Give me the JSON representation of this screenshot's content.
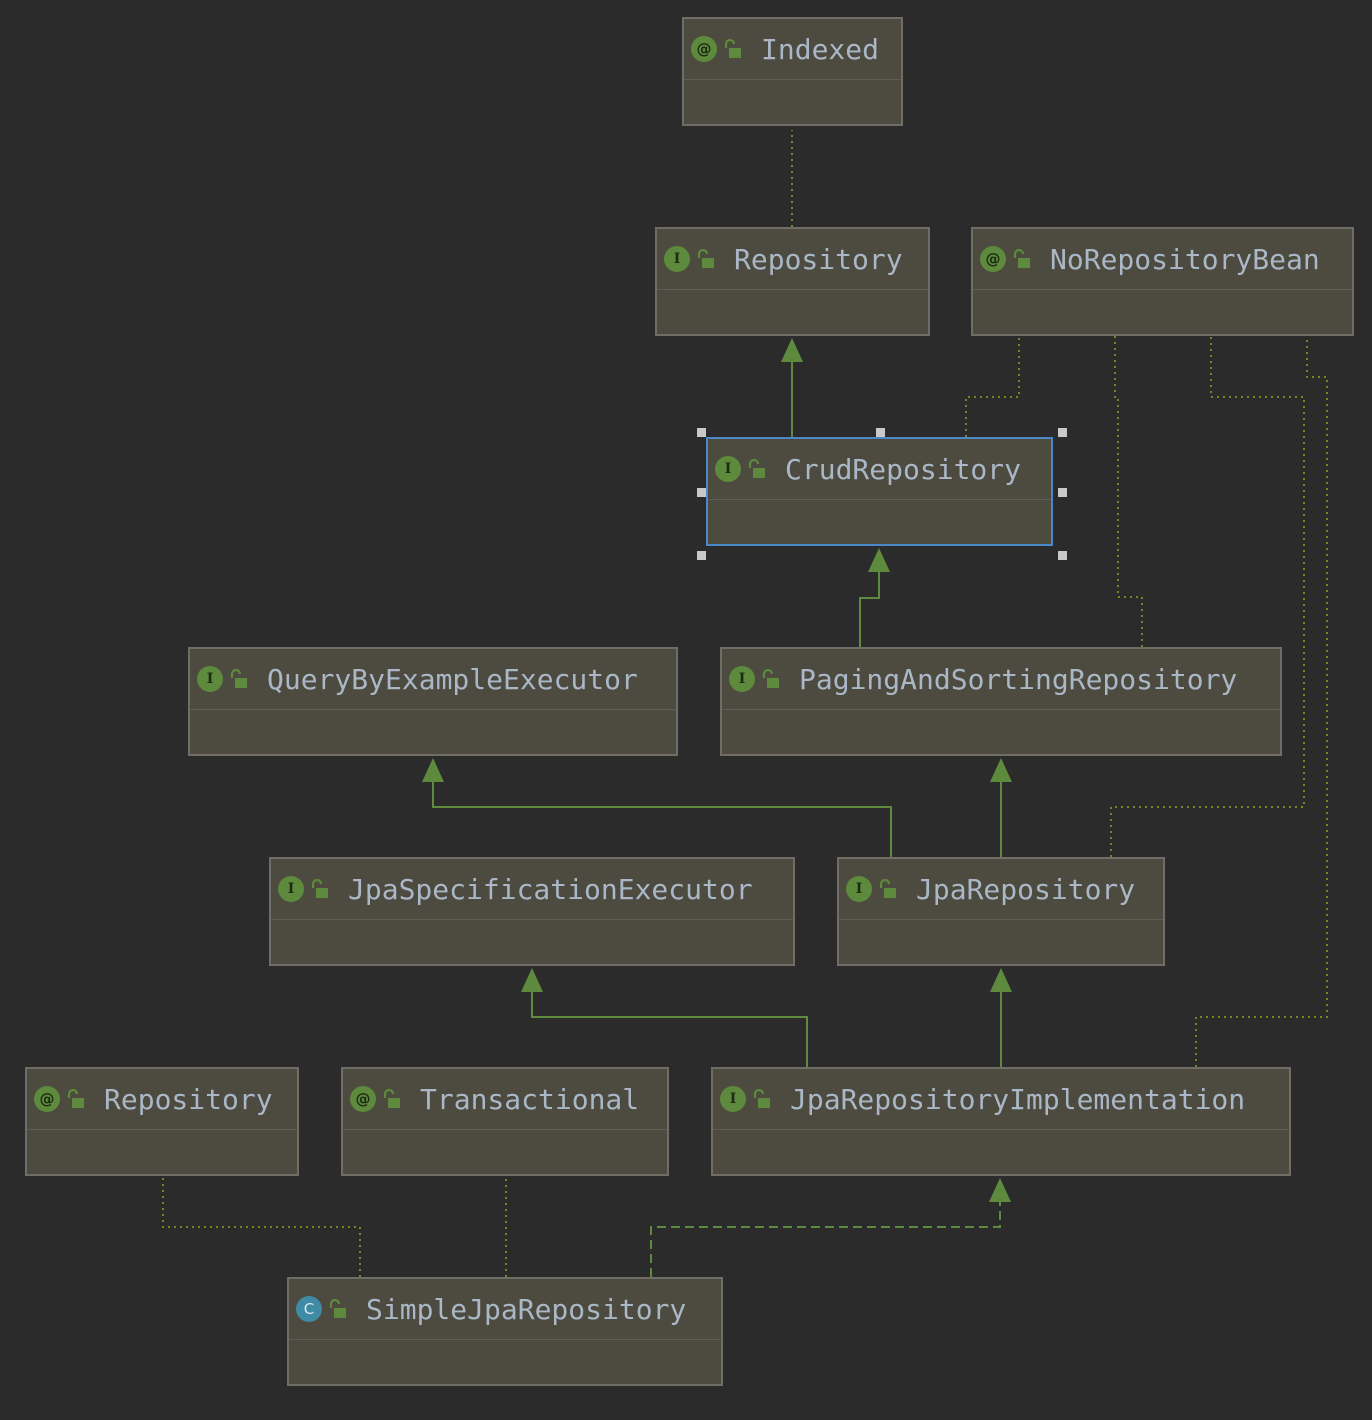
{
  "nodes": [
    {
      "id": "indexed",
      "name": "Indexed",
      "kind": "annotation",
      "badge": "@"
    },
    {
      "id": "repository",
      "name": "Repository",
      "kind": "interface",
      "badge": "I"
    },
    {
      "id": "no-repository-bean",
      "name": "NoRepositoryBean",
      "kind": "annotation",
      "badge": "@"
    },
    {
      "id": "crud-repository",
      "name": "CrudRepository",
      "kind": "interface",
      "badge": "I",
      "selected": true
    },
    {
      "id": "query-by-example-executor",
      "name": "QueryByExampleExecutor",
      "kind": "interface",
      "badge": "I"
    },
    {
      "id": "paging-and-sorting-repository",
      "name": "PagingAndSortingRepository",
      "kind": "interface",
      "badge": "I"
    },
    {
      "id": "jpa-specification-executor",
      "name": "JpaSpecificationExecutor",
      "kind": "interface",
      "badge": "I"
    },
    {
      "id": "jpa-repository",
      "name": "JpaRepository",
      "kind": "interface",
      "badge": "I"
    },
    {
      "id": "repository-annotation",
      "name": "Repository",
      "kind": "annotation",
      "badge": "@"
    },
    {
      "id": "transactional",
      "name": "Transactional",
      "kind": "annotation",
      "badge": "@"
    },
    {
      "id": "jpa-repository-implementation",
      "name": "JpaRepositoryImplementation",
      "kind": "interface",
      "badge": "I"
    },
    {
      "id": "simple-jpa-repository",
      "name": "SimpleJpaRepository",
      "kind": "class",
      "badge": "C"
    }
  ],
  "edges": [
    {
      "from": "crud-repository",
      "to": "repository",
      "type": "extends"
    },
    {
      "from": "paging-and-sorting-repository",
      "to": "crud-repository",
      "type": "extends"
    },
    {
      "from": "jpa-repository",
      "to": "query-by-example-executor",
      "type": "extends"
    },
    {
      "from": "jpa-repository",
      "to": "paging-and-sorting-repository",
      "type": "extends"
    },
    {
      "from": "jpa-repository-implementation",
      "to": "jpa-specification-executor",
      "type": "extends"
    },
    {
      "from": "jpa-repository-implementation",
      "to": "jpa-repository",
      "type": "extends"
    },
    {
      "from": "simple-jpa-repository",
      "to": "jpa-repository-implementation",
      "type": "implements"
    },
    {
      "from": "repository",
      "to": "indexed",
      "type": "annotated"
    },
    {
      "from": "crud-repository",
      "to": "no-repository-bean",
      "type": "annotated"
    },
    {
      "from": "paging-and-sorting-repository",
      "to": "no-repository-bean",
      "type": "annotated"
    },
    {
      "from": "jpa-repository",
      "to": "no-repository-bean",
      "type": "annotated"
    },
    {
      "from": "jpa-repository-implementation",
      "to": "no-repository-bean",
      "type": "annotated"
    },
    {
      "from": "simple-jpa-repository",
      "to": "repository-annotation",
      "type": "annotated"
    },
    {
      "from": "simple-jpa-repository",
      "to": "transactional",
      "type": "annotated"
    }
  ],
  "colors": {
    "background": "#2b2b2b",
    "node_fill": "#4d4a3f",
    "node_border": "#6f6d66",
    "selected_border": "#4a88c7",
    "name_text": "#a9b7c6",
    "extends_line": "#5d8a3c",
    "annotation_line": "#6e8a1e",
    "interface_badge": "#5d8a3c",
    "class_badge": "#3f8ba6"
  }
}
